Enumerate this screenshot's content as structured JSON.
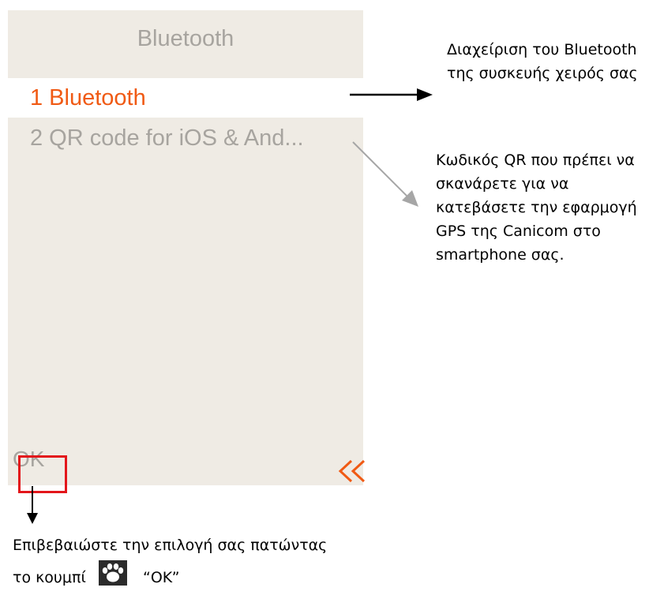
{
  "screen": {
    "title": "Bluetooth",
    "menu_items": [
      {
        "label": "1 Bluetooth",
        "selected": true
      },
      {
        "label": "2 QR code for iOS & And...",
        "selected": false
      }
    ],
    "ok_label": "OK",
    "back_icon": "double-chevron-left-icon"
  },
  "annotations": {
    "bluetooth_note": "Διαχείριση του Bluetooth της συσκευής χειρός σας",
    "qr_note": "Κωδικός QR που πρέπει να σκανάρετε για να κατεβάσετε την εφαρμογή GPS της Canicom στο smartphone σας.",
    "ok_note_text": "Επιβεβαιώστε την επιλογή σας πατώντας το κουμπί",
    "ok_note_button": "“OK”",
    "paw_icon": "paw-icon"
  },
  "colors": {
    "screen_bg": "#efebe4",
    "accent": "#f05a14",
    "muted_text": "#a7a49f",
    "highlight_box": "#e3161b"
  }
}
